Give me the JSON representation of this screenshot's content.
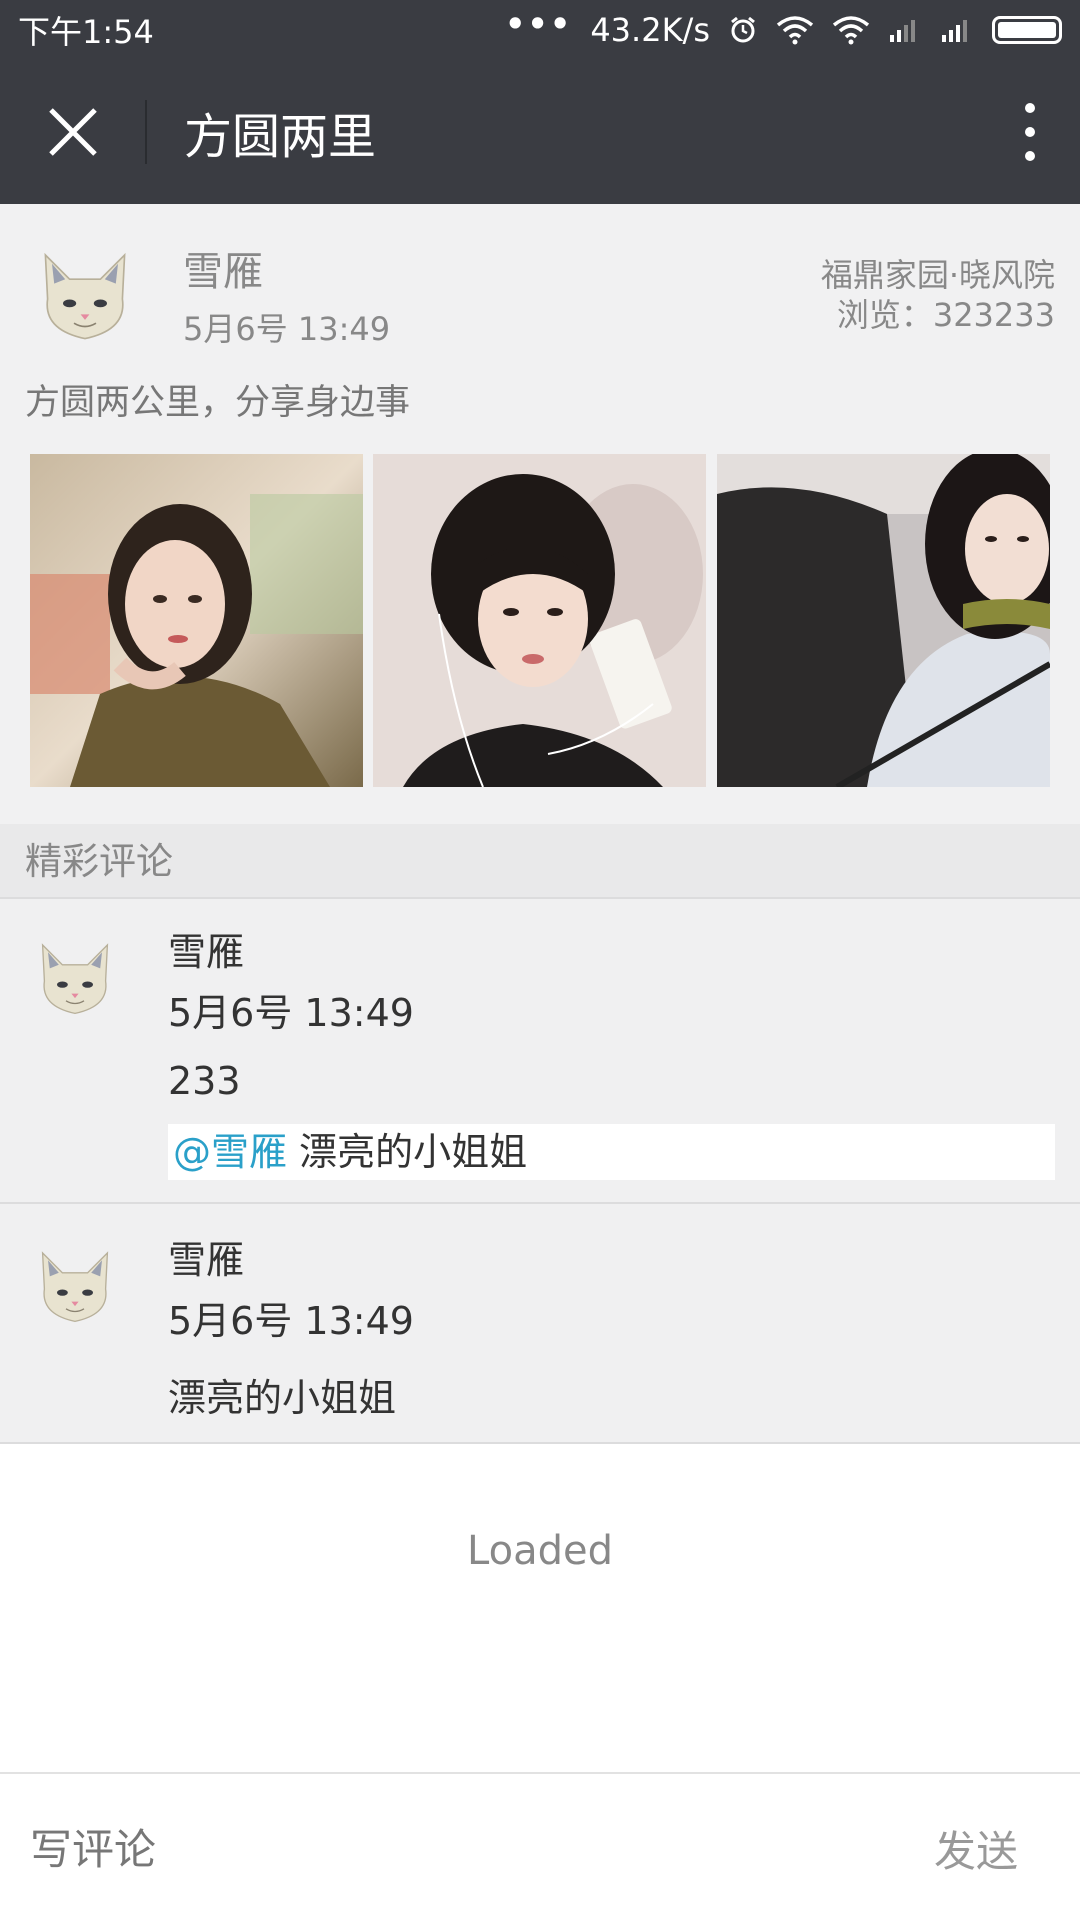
{
  "status_bar": {
    "time": "下午1:54",
    "dots": "•••",
    "speed": "43.2K/s",
    "icons": [
      "alarm-icon",
      "wifi-icon",
      "wifi-hotspot-icon",
      "signal-icon",
      "signal-icon",
      "battery-icon"
    ]
  },
  "header": {
    "title": "方圆两里",
    "close_icon": "close-icon",
    "more_icon": "more-vertical-icon"
  },
  "post": {
    "author": "雪雁",
    "time": "5月6号 13:49",
    "location": "福鼎家园·晓风院",
    "views": "浏览：323233",
    "text": "方圆两公里，分享身边事",
    "photo_count": 3
  },
  "comments_section": {
    "title": "精彩评论",
    "comments": [
      {
        "name": "雪雁",
        "time": "5月6号 13:49",
        "text": "233",
        "reply_mention": "@雪雁",
        "reply_text": " 漂亮的小姐姐"
      },
      {
        "name": "雪雁",
        "time": "5月6号 13:49",
        "text": "漂亮的小姐姐"
      }
    ]
  },
  "load_status": "Loaded",
  "footer": {
    "input_placeholder": "写评论",
    "send_label": "发送"
  },
  "colors": {
    "header_bg": "#3a3c42",
    "mention": "#2aa0c9",
    "content_bg": "#f1f1f2"
  }
}
